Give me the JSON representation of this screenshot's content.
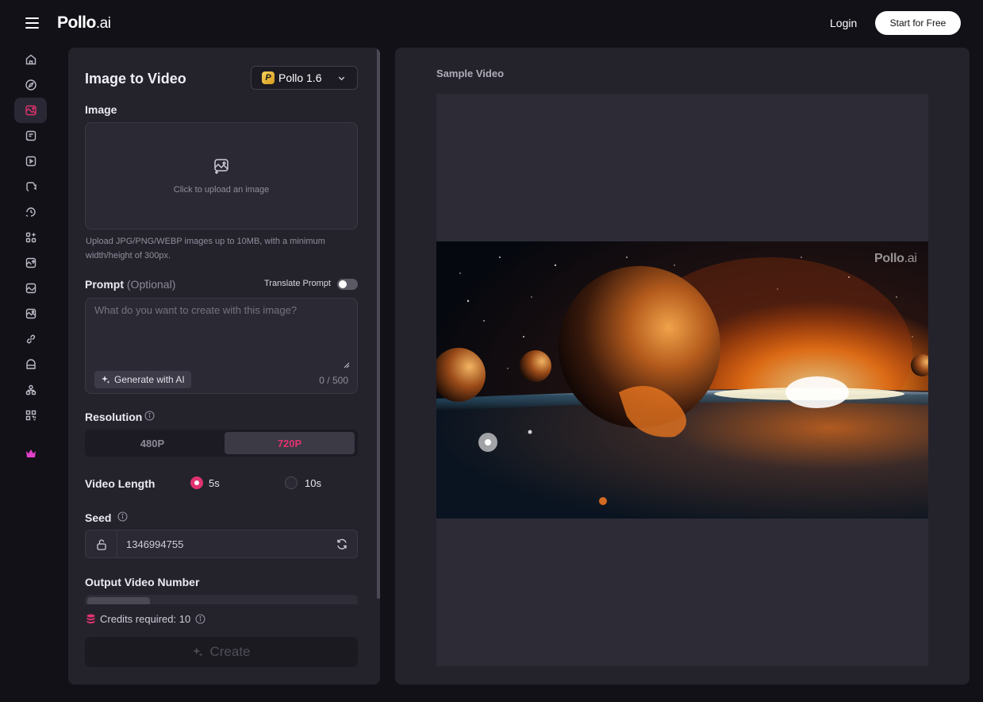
{
  "header": {
    "menu_icon": "hamburger-icon",
    "logo_main": "Pollo",
    "logo_suffix": ".ai",
    "login_label": "Login",
    "start_label": "Start for Free"
  },
  "sidebar": {
    "items": [
      {
        "icon": "home-icon"
      },
      {
        "icon": "compass-icon"
      },
      {
        "icon": "image-to-video-icon",
        "active": true
      },
      {
        "icon": "text-to-video-icon"
      },
      {
        "icon": "video-to-video-icon"
      },
      {
        "icon": "video-tools-icon"
      },
      {
        "icon": "video-history-icon"
      },
      {
        "icon": "apps-icon"
      },
      {
        "icon": "image-upload-icon"
      },
      {
        "icon": "image-edit-icon"
      },
      {
        "icon": "image-effects-icon"
      },
      {
        "icon": "link-icon"
      },
      {
        "icon": "template-icon"
      },
      {
        "icon": "community-icon"
      },
      {
        "icon": "qr-icon"
      },
      {
        "icon": "crown-icon"
      }
    ],
    "accent_color": "#e0336f",
    "crown_color": "#e040c8"
  },
  "panel": {
    "title": "Image to Video",
    "model": {
      "badge": "P",
      "name": "Pollo 1.6"
    },
    "image_label": "Image",
    "upload_text": "Click to upload an image",
    "upload_hint": "Upload JPG/PNG/WEBP images up to 10MB, with a minimum width/height of 300px.",
    "prompt_label": "Prompt",
    "prompt_optional": "(Optional)",
    "translate_label": "Translate Prompt",
    "translate_on": false,
    "prompt_placeholder": "What do you want to create with this image?",
    "generate_label": "Generate with AI",
    "char_count": "0 / 500",
    "resolution_label": "Resolution",
    "resolution_options": [
      "480P",
      "720P"
    ],
    "resolution_selected": "720P",
    "length_label": "Video Length",
    "length_options": [
      "5s",
      "10s"
    ],
    "length_selected": "5s",
    "seed_label": "Seed",
    "seed_value": "1346994755",
    "output_label": "Output Video Number",
    "credits_text": "Credits required: 10",
    "create_label": "Create"
  },
  "preview": {
    "label": "Sample Video",
    "watermark_main": "Pollo",
    "watermark_suffix": ".ai"
  }
}
